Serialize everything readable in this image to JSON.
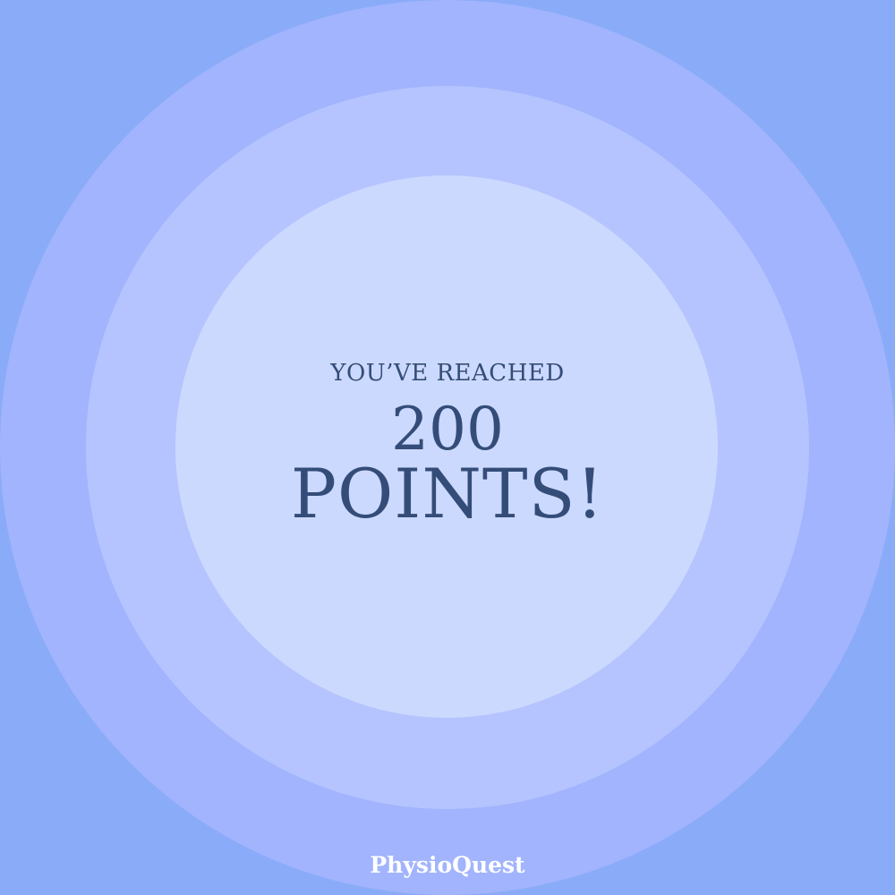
{
  "message": {
    "eyebrow": "YOU’VE REACHED",
    "points_value": "200",
    "points_word": "POINTS!"
  },
  "brand": {
    "name": "PhysioQuest"
  },
  "colors": {
    "background": "#8aabf8",
    "ring_outer": "#a1b4fd",
    "ring_middle": "#b5c4fe",
    "ring_inner": "#ccd9fe",
    "text": "#344d78",
    "brand_text": "#ffffff"
  }
}
